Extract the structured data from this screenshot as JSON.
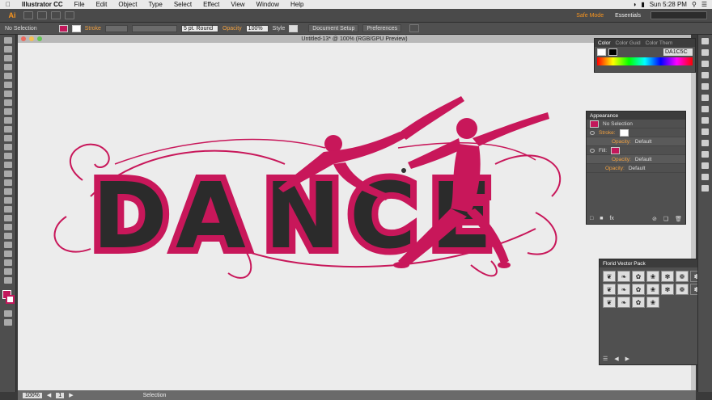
{
  "menubar": {
    "app_name": "Illustrator CC",
    "items": [
      "File",
      "Edit",
      "Object",
      "Type",
      "Select",
      "Effect",
      "View",
      "Window",
      "Help"
    ],
    "clock": "Sun 5:28 PM"
  },
  "appbar": {
    "logo": "Ai",
    "safe_mode": "Safe Mode",
    "workspace": "Essentials"
  },
  "controlbar": {
    "selection_label": "No Selection",
    "stroke_label": "Stroke",
    "brush": "5 pt. Round",
    "opacity_label": "Opacity",
    "opacity_value": "100%",
    "style_label": "Style",
    "doc_setup": "Document Setup",
    "preferences": "Preferences",
    "fill_color": "#c2185b"
  },
  "document": {
    "title": "Untitled-13* @ 100% (RGB/GPU Preview)"
  },
  "artwork": {
    "letters": [
      "D",
      "A",
      "N",
      "C",
      "E"
    ],
    "fill": "#2b2b2b",
    "outline": "#c8175a"
  },
  "color_panel": {
    "tabs": [
      "Color",
      "Color Guid",
      "Color Them"
    ],
    "hex": "DA1C5C"
  },
  "appearance_panel": {
    "title": "Appearance",
    "rows": [
      {
        "label": "No Selection"
      },
      {
        "label": "Stroke:"
      },
      {
        "label": "Opacity:",
        "value": "Default"
      },
      {
        "label": "Fill:"
      },
      {
        "label": "Opacity:",
        "value": "Default"
      },
      {
        "label": "Opacity:",
        "value": "Default"
      }
    ]
  },
  "florid_panel": {
    "title": "Florid Vector Pack",
    "count": 18
  },
  "statusbar": {
    "zoom": "100%",
    "page": "1",
    "tool": "Selection"
  }
}
